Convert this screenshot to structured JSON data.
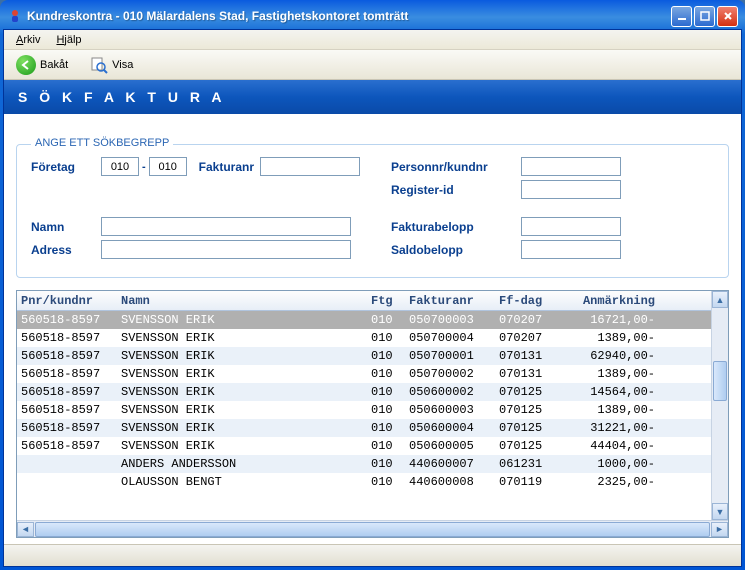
{
  "window": {
    "title": "Kundreskontra  -  010 Mälardalens Stad, Fastighetskontoret tomträtt"
  },
  "menubar": {
    "arkiv": "Arkiv",
    "hjalp": "Hjälp"
  },
  "toolbar": {
    "back": "Bakåt",
    "visa": "Visa"
  },
  "header": {
    "title": "S Ö K   F A K T U R A"
  },
  "search": {
    "legend": "ANGE ETT SÖKBEGREPP",
    "foretag_label": "Företag",
    "foretag_from": "010",
    "foretag_to": "010",
    "fakturanr_label": "Fakturanr",
    "fakturanr": "",
    "personnr_label": "Personnr/kundnr",
    "personnr": "",
    "registerid_label": "Register-id",
    "registerid": "",
    "namn_label": "Namn",
    "namn": "",
    "adress_label": "Adress",
    "adress": "",
    "fakturabelopp_label": "Fakturabelopp",
    "fakturabelopp": "",
    "saldobelopp_label": "Saldobelopp",
    "saldobelopp": ""
  },
  "grid": {
    "headers": {
      "pnr": "Pnr/kundnr",
      "namn": "Namn",
      "ftg": "Ftg",
      "fnr": "Fakturanr",
      "ffd": "Ff-dag",
      "anm": "Anmärkning"
    },
    "rows": [
      {
        "pnr": "560518-8597",
        "namn": "SVENSSON ERIK",
        "ftg": "010",
        "fnr": "050700003",
        "ffd": "070207",
        "anm": "16721,00-"
      },
      {
        "pnr": "560518-8597",
        "namn": "SVENSSON ERIK",
        "ftg": "010",
        "fnr": "050700004",
        "ffd": "070207",
        "anm": "1389,00-"
      },
      {
        "pnr": "560518-8597",
        "namn": "SVENSSON ERIK",
        "ftg": "010",
        "fnr": "050700001",
        "ffd": "070131",
        "anm": "62940,00-"
      },
      {
        "pnr": "560518-8597",
        "namn": "SVENSSON ERIK",
        "ftg": "010",
        "fnr": "050700002",
        "ffd": "070131",
        "anm": "1389,00-"
      },
      {
        "pnr": "560518-8597",
        "namn": "SVENSSON ERIK",
        "ftg": "010",
        "fnr": "050600002",
        "ffd": "070125",
        "anm": "14564,00-"
      },
      {
        "pnr": "560518-8597",
        "namn": "SVENSSON ERIK",
        "ftg": "010",
        "fnr": "050600003",
        "ffd": "070125",
        "anm": "1389,00-"
      },
      {
        "pnr": "560518-8597",
        "namn": "SVENSSON ERIK",
        "ftg": "010",
        "fnr": "050600004",
        "ffd": "070125",
        "anm": "31221,00-"
      },
      {
        "pnr": "560518-8597",
        "namn": "SVENSSON ERIK",
        "ftg": "010",
        "fnr": "050600005",
        "ffd": "070125",
        "anm": "44404,00-"
      },
      {
        "pnr": "",
        "namn": "ANDERS ANDERSSON",
        "ftg": "010",
        "fnr": "440600007",
        "ffd": "061231",
        "anm": "1000,00-"
      },
      {
        "pnr": "",
        "namn": "OLAUSSON BENGT",
        "ftg": "010",
        "fnr": "440600008",
        "ffd": "070119",
        "anm": "2325,00-"
      }
    ]
  }
}
